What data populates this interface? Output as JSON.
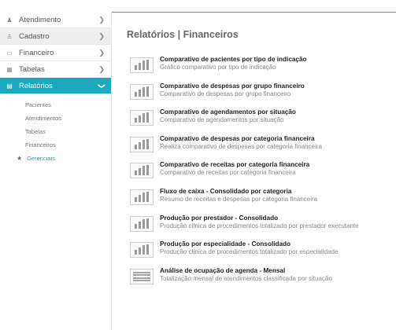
{
  "sidebar": {
    "items": [
      {
        "label": "Atendimento",
        "icon": "person-icon",
        "glyph": "♟"
      },
      {
        "label": "Cadastro",
        "icon": "user-add-icon",
        "glyph": "♙"
      },
      {
        "label": "Financeiro",
        "icon": "money-icon",
        "glyph": "▭"
      },
      {
        "label": "Tabelas",
        "icon": "grid-icon",
        "glyph": "▦"
      },
      {
        "label": "Relatórios",
        "icon": "document-icon",
        "glyph": "▤"
      }
    ],
    "subitems": [
      "Pacientes",
      "Atendimentos",
      "Tabelas",
      "Financeiros"
    ],
    "favorites": "Gerenciais"
  },
  "main": {
    "title": "Relatórios | Financeiros",
    "reports": [
      {
        "title": "Comparativo de pacientes por tipo de indicação",
        "desc": "Gráfico comparativo por tipo de indicação"
      },
      {
        "title": "Comparativo de despesas por grupo financeiro",
        "desc": "Comparativo de despesas por grupo financeiro"
      },
      {
        "title": "Comparativo de agendamentos por situação",
        "desc": "Comparativo de agendamentos por situação"
      },
      {
        "title": "Comparativo de despesas por categoria financeira",
        "desc": "Realiza comparativo de despesas por categoria financeira"
      },
      {
        "title": "Comparativo de receitas por categoria financeira",
        "desc": "Comparativo de receitas por categoria financeira"
      },
      {
        "title": "Fluxo de caixa - Consolidado por categoria",
        "desc": "Resumo de receitas e despesas por categoria financeira"
      },
      {
        "title": "Produção por prestador - Consolidado",
        "desc": "Produção clínica de procedimentos totalizado por prestador executante"
      },
      {
        "title": "Produção por especialidade - Consolidado",
        "desc": "Produção clínica de procedimentos totalizado por especialidade"
      },
      {
        "title": "Análise de ocupação de agenda - Mensal",
        "desc": "Totalização mensal de atendimentos classificada por situação"
      }
    ]
  },
  "colors": {
    "accent": "#1aa9bd",
    "topline": "#25a9c8"
  }
}
